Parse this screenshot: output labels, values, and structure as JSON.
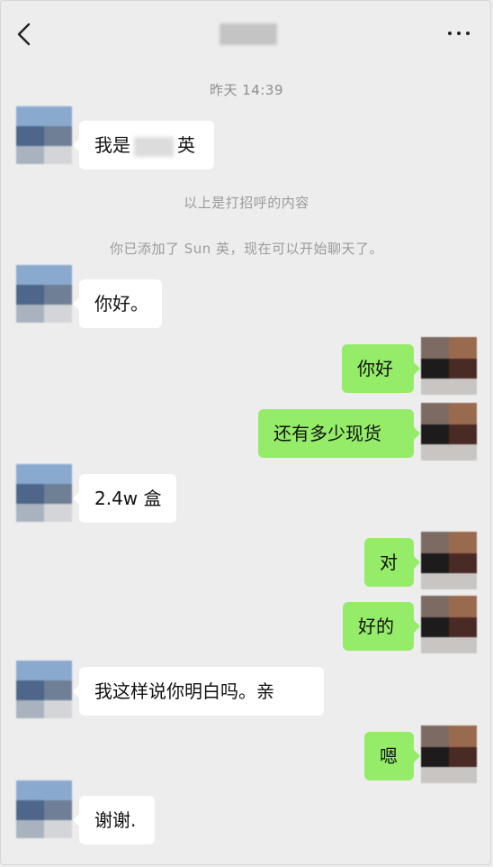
{
  "header": {
    "back_icon": "chevron-left-icon",
    "more_icon": "more-dots-icon"
  },
  "timestamp": "昨天 14:39",
  "system_messages": [
    "以上是打招呼的内容",
    "你已添加了 Sun 英，现在可以开始聊天了。"
  ],
  "messages": [
    {
      "side": "in",
      "text_prefix": "我是",
      "text_suffix": "英",
      "redacted": true
    },
    {
      "side": "in",
      "text": "你好。"
    },
    {
      "side": "out",
      "text": "你好"
    },
    {
      "side": "out",
      "text": "还有多少现货"
    },
    {
      "side": "in",
      "text": "2.4w 盒"
    },
    {
      "side": "out",
      "text": "对"
    },
    {
      "side": "out",
      "text": "好的"
    },
    {
      "side": "in",
      "text": "我这样说你明白吗。亲"
    },
    {
      "side": "out",
      "text": "嗯"
    },
    {
      "side": "in",
      "text": "谢谢."
    }
  ],
  "colors": {
    "background": "#ededed",
    "outgoing_bubble": "#95ec69",
    "incoming_bubble": "#ffffff",
    "system_text": "#9b9b9b"
  }
}
